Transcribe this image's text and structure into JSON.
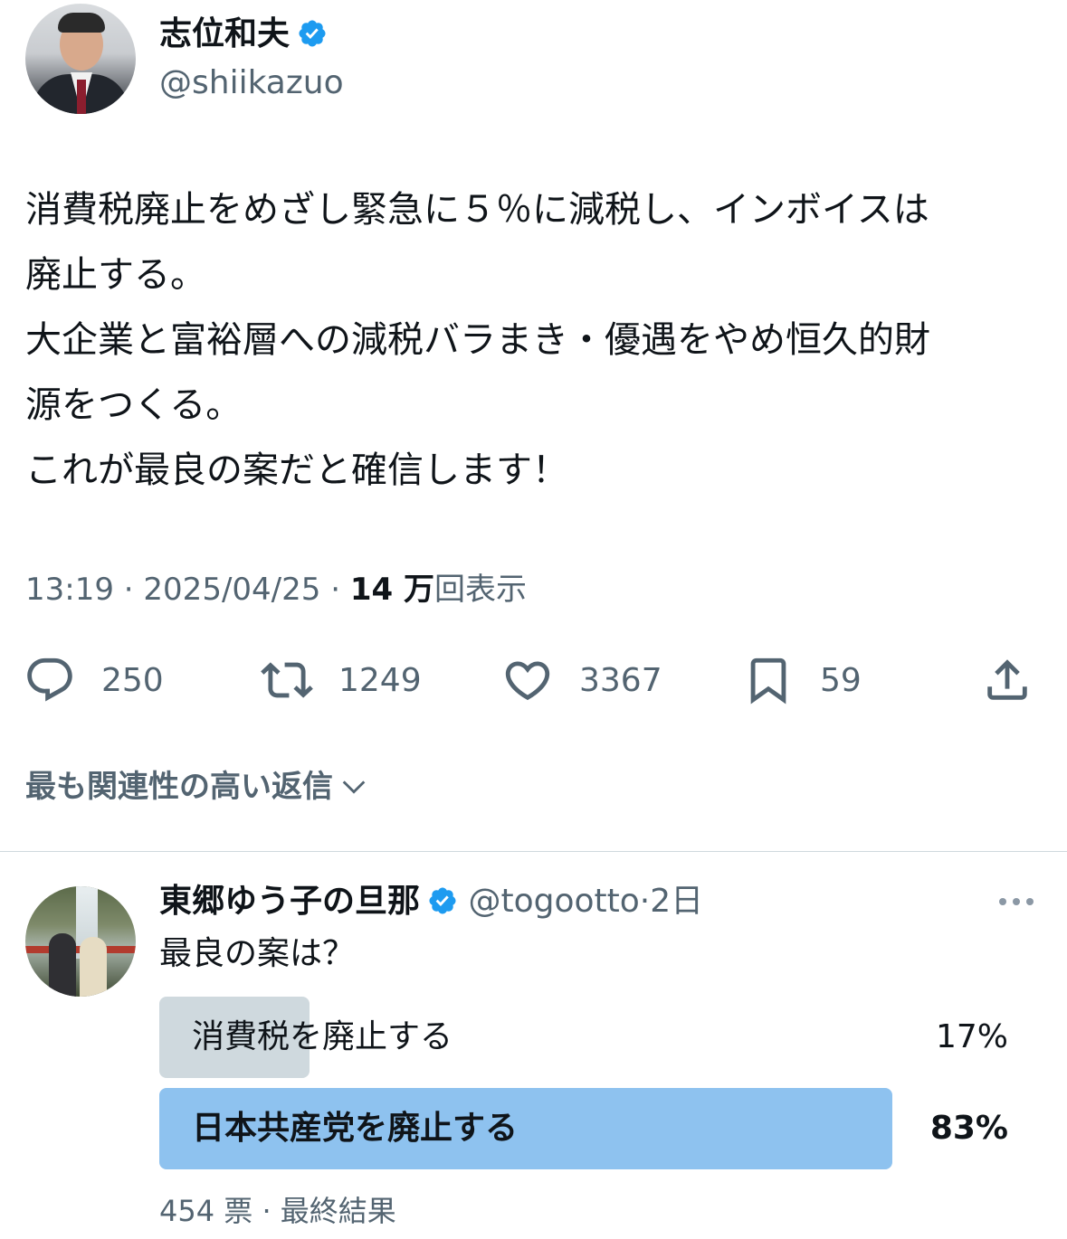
{
  "tweet": {
    "author_name": "志位和夫",
    "author_handle": "@shiikazuo",
    "text": "消費税廃止をめざし緊急に５％に減税し、インボイスは\n廃止する。\n大企業と富裕層への減税バラまき・優遇をやめ恒久的財\n源をつくる。\nこれが最良の案だと確信します！",
    "time": "13:19",
    "date": "2025/04/25",
    "views_count": "14 万",
    "views_label": "回表示",
    "separator": "·",
    "actions": {
      "reply": {
        "icon": "reply-icon",
        "count": "250"
      },
      "retweet": {
        "icon": "retweet-icon",
        "count": "1249"
      },
      "like": {
        "icon": "heart-icon",
        "count": "3367"
      },
      "bookmark": {
        "icon": "bookmark-icon",
        "count": "59"
      },
      "share": {
        "icon": "share-icon"
      }
    }
  },
  "replies_sort_label": "最も関連性の高い返信",
  "reply": {
    "author_name": "東郷ゆう子の旦那",
    "author_handle": "@togootto",
    "separator": "·",
    "age": "2日",
    "text": "最良の案は？",
    "poll": {
      "options": [
        {
          "label": "消費税を廃止する",
          "percent": "17%",
          "fraction": 0.17,
          "winner": false
        },
        {
          "label": "日本共産党を廃止する",
          "percent": "83%",
          "fraction": 0.83,
          "winner": true
        }
      ],
      "votes": "454 票",
      "separator": "·",
      "status": "最終結果"
    }
  },
  "colors": {
    "verified": "#1d9bf0",
    "secondary_text": "#536471",
    "poll_loser": "#cfd9de",
    "poll_winner": "#8ec2ef"
  }
}
